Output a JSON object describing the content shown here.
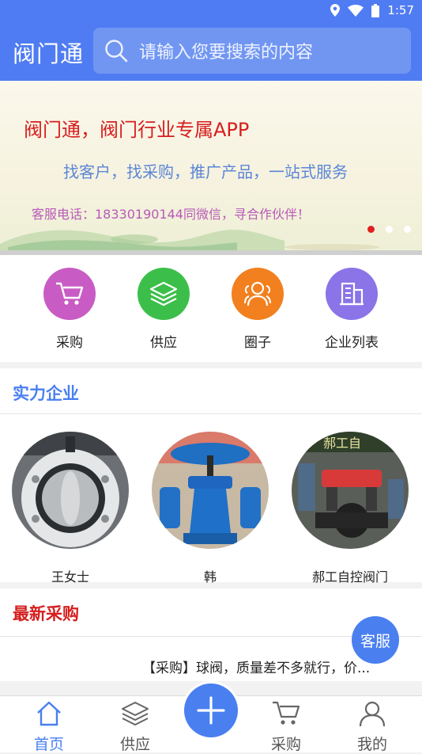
{
  "status_bar": {
    "time": "1:57"
  },
  "header": {
    "app_title": "阀门通",
    "search_placeholder": "请输入您要搜索的内容"
  },
  "banner": {
    "line1": "阀门通，阀门行业专属APP",
    "line2": "找客户，找采购，推广产品，一站式服务",
    "line3": "客服电话：18330190144同微信，寻合作伙伴！",
    "slide_count": 3,
    "active_slide": 1
  },
  "categories": [
    {
      "label": "采购",
      "icon": "cart-icon",
      "color": "#c85cc4"
    },
    {
      "label": "供应",
      "icon": "layers-icon",
      "color": "#3cbf4a"
    },
    {
      "label": "圈子",
      "icon": "group-icon",
      "color": "#f2801e"
    },
    {
      "label": "企业列表",
      "icon": "building-icon",
      "color": "#8a74e8"
    }
  ],
  "strong_companies": {
    "title": "实力企业",
    "items": [
      {
        "name": "王女士"
      },
      {
        "name": "韩"
      },
      {
        "name": "郝工自控阀门"
      }
    ]
  },
  "latest_purchase": {
    "title": "最新采购",
    "items": [
      {
        "text": "【采购】球阀，质量差不多就行，价..."
      }
    ]
  },
  "service_button": "客服",
  "tabbar": {
    "items": [
      {
        "label": "首页",
        "icon": "home-icon",
        "active": true
      },
      {
        "label": "供应",
        "icon": "layers-icon",
        "active": false
      },
      {
        "label": "采购",
        "icon": "cart-icon",
        "active": false
      },
      {
        "label": "我的",
        "icon": "user-icon",
        "active": false
      }
    ],
    "center_icon": "plus-icon"
  },
  "colors": {
    "primary": "#4f7cf2",
    "accent_red": "#d51e1e",
    "section_blue": "#4a7ff0"
  }
}
